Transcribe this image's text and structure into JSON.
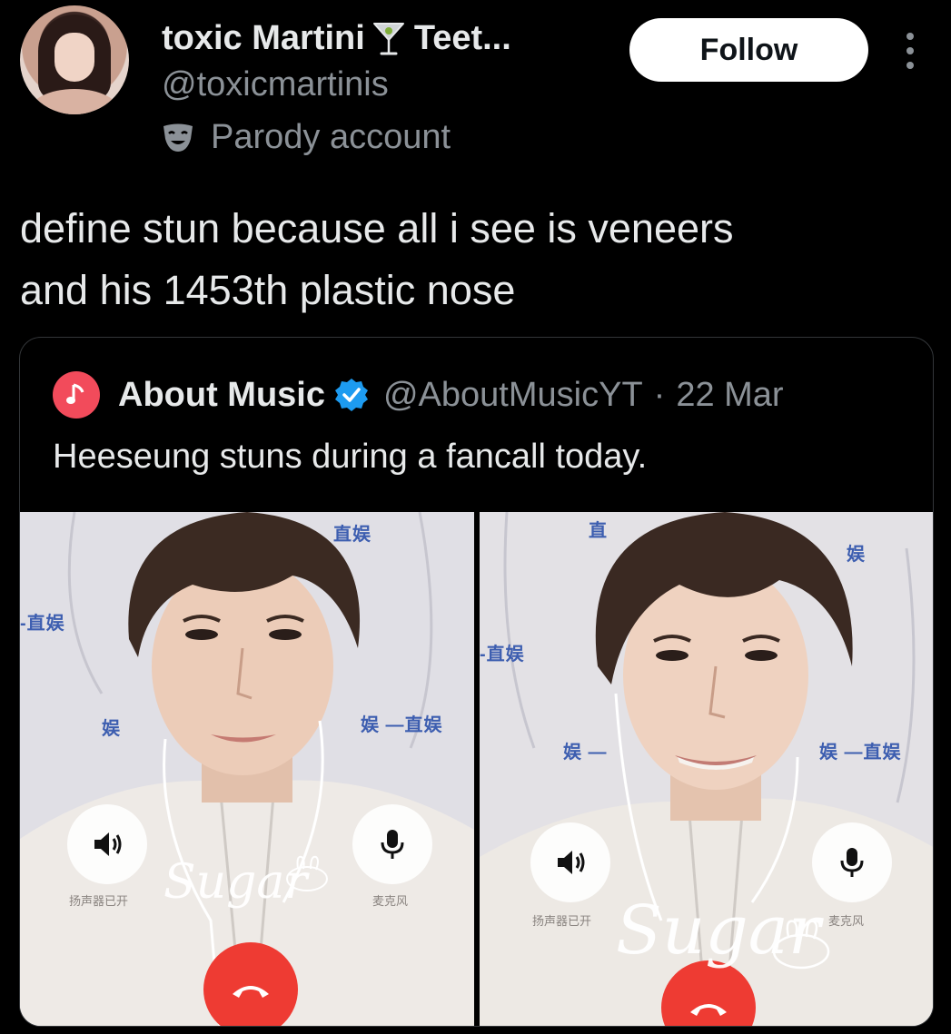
{
  "author": {
    "display_name": "toxic Martini",
    "name_suffix": "Teet...",
    "name_emoji_icon": "martini-glass-icon",
    "handle": "@toxicmartinis",
    "label_icon": "theater-mask-icon",
    "label": "Parody account"
  },
  "actions": {
    "follow_label": "Follow",
    "more_icon": "more-vertical-icon"
  },
  "tweet": {
    "line1": "define stun because all i see is veneers",
    "line2": "and his 1453th plastic nose"
  },
  "quoted": {
    "avatar_icon": "music-note-icon",
    "name": "About Music",
    "verified_icon": "verified-badge-icon",
    "handle": "@AboutMusicYT",
    "separator": "·",
    "date": "22 Mar",
    "text": "Heeseung stuns during a fancall today."
  },
  "media": {
    "left": {
      "banner_top": "直娱",
      "banner_side": "-直娱",
      "banner_mid_a": "娱",
      "banner_mid_b": "娱 —直娱",
      "speaker_label": "扬声器已开",
      "mic_label": "麦克风",
      "watermark": "Sugar"
    },
    "right": {
      "banner_top_a": "直",
      "banner_top_b": "娱",
      "banner_side": "-直娱",
      "banner_mid_a": "娱 —",
      "banner_mid_b": "娱 —直娱",
      "speaker_label": "扬声器已开",
      "mic_label": "麦克风",
      "watermark": "Sugar"
    }
  },
  "colors": {
    "background": "#000000",
    "text_primary": "#e7e9ea",
    "text_secondary": "#8b9197",
    "follow_bg": "#ffffff",
    "verified": "#1d9bf0",
    "hangup": "#ee3b33",
    "music_logo": "#f24b5b"
  }
}
